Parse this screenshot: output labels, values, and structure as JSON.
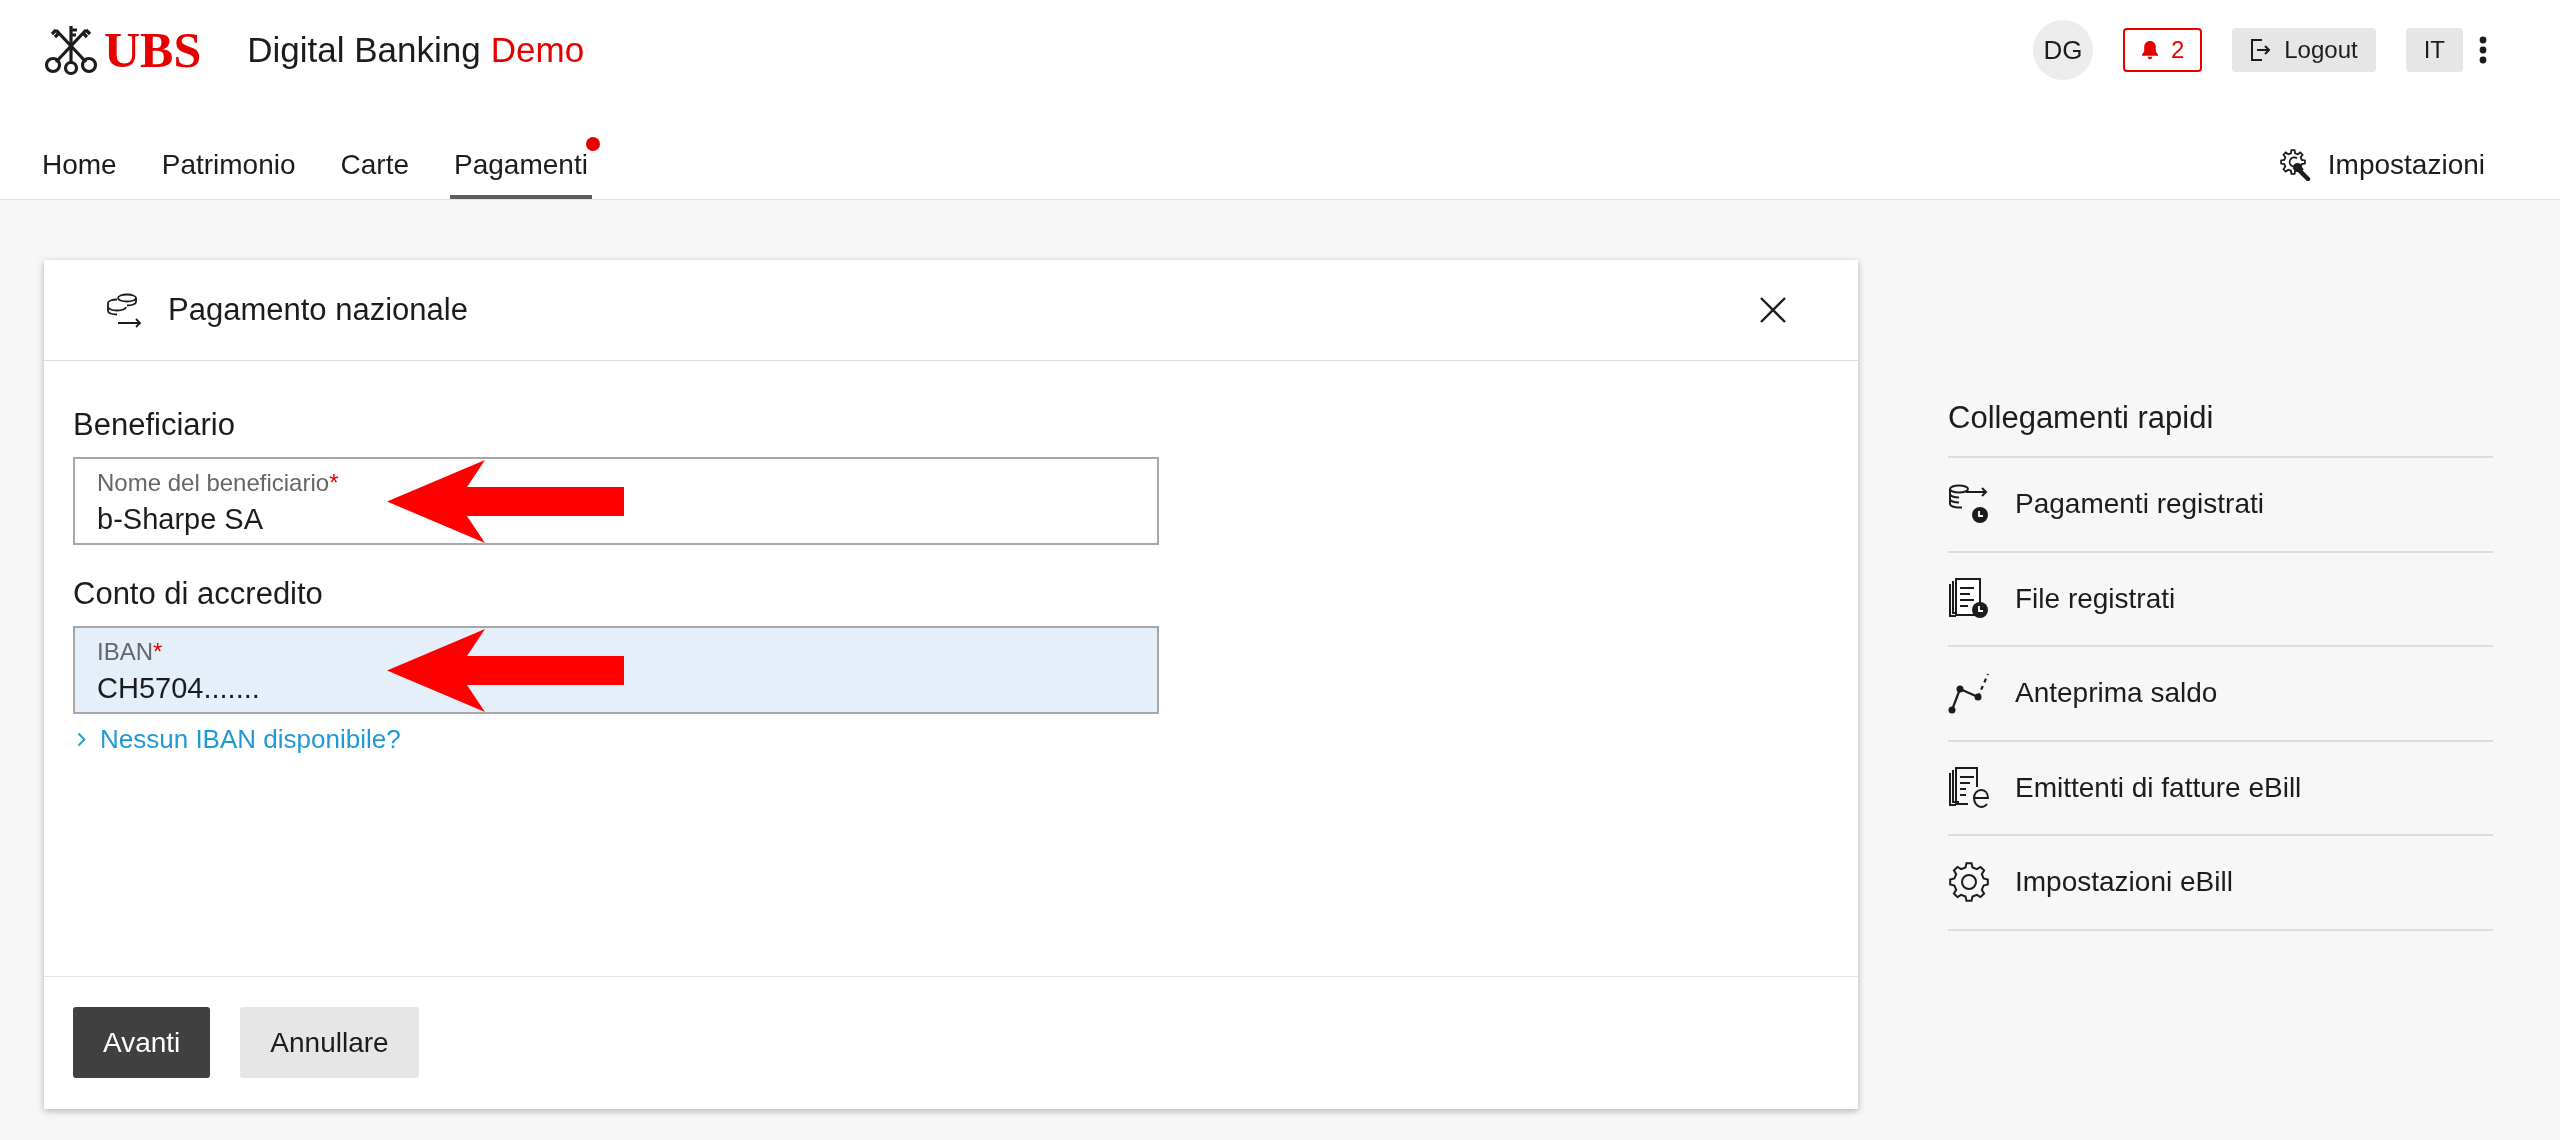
{
  "header": {
    "brand": "UBS",
    "app_title": "Digital Banking",
    "app_badge": "Demo",
    "user_initials": "DG",
    "notification_count": "2",
    "logout": "Logout",
    "language": "IT"
  },
  "nav": {
    "tabs": [
      {
        "label": "Home",
        "selected": false,
        "dot": false
      },
      {
        "label": "Patrimonio",
        "selected": false,
        "dot": false
      },
      {
        "label": "Carte",
        "selected": false,
        "dot": false
      },
      {
        "label": "Pagamenti",
        "selected": true,
        "dot": true
      }
    ],
    "settings": "Impostazioni"
  },
  "dialog": {
    "title": "Pagamento nazionale",
    "sections": [
      {
        "heading": "Beneficiario",
        "field": {
          "label": "Nome del beneficiario",
          "required_mark": "*",
          "value": "b-Sharpe SA",
          "focused": false,
          "arrow": true
        }
      },
      {
        "heading": "Conto di accredito",
        "field": {
          "label": "IBAN",
          "required_mark": "*",
          "value": "CH5704.......",
          "focused": true,
          "arrow": true
        },
        "link": "Nessun IBAN disponibile?"
      }
    ],
    "buttons": [
      {
        "label": "Avanti",
        "kind": "primary"
      },
      {
        "label": "Annullare",
        "kind": "secondary"
      }
    ]
  },
  "quick_links": {
    "title": "Collegamenti rapidi",
    "items": [
      {
        "label": "Pagamenti registrati"
      },
      {
        "label": "File registrati"
      },
      {
        "label": "Anteprima saldo"
      },
      {
        "label": "Emittenti di fatture eBill"
      },
      {
        "label": "Impostazioni eBill"
      }
    ]
  }
}
